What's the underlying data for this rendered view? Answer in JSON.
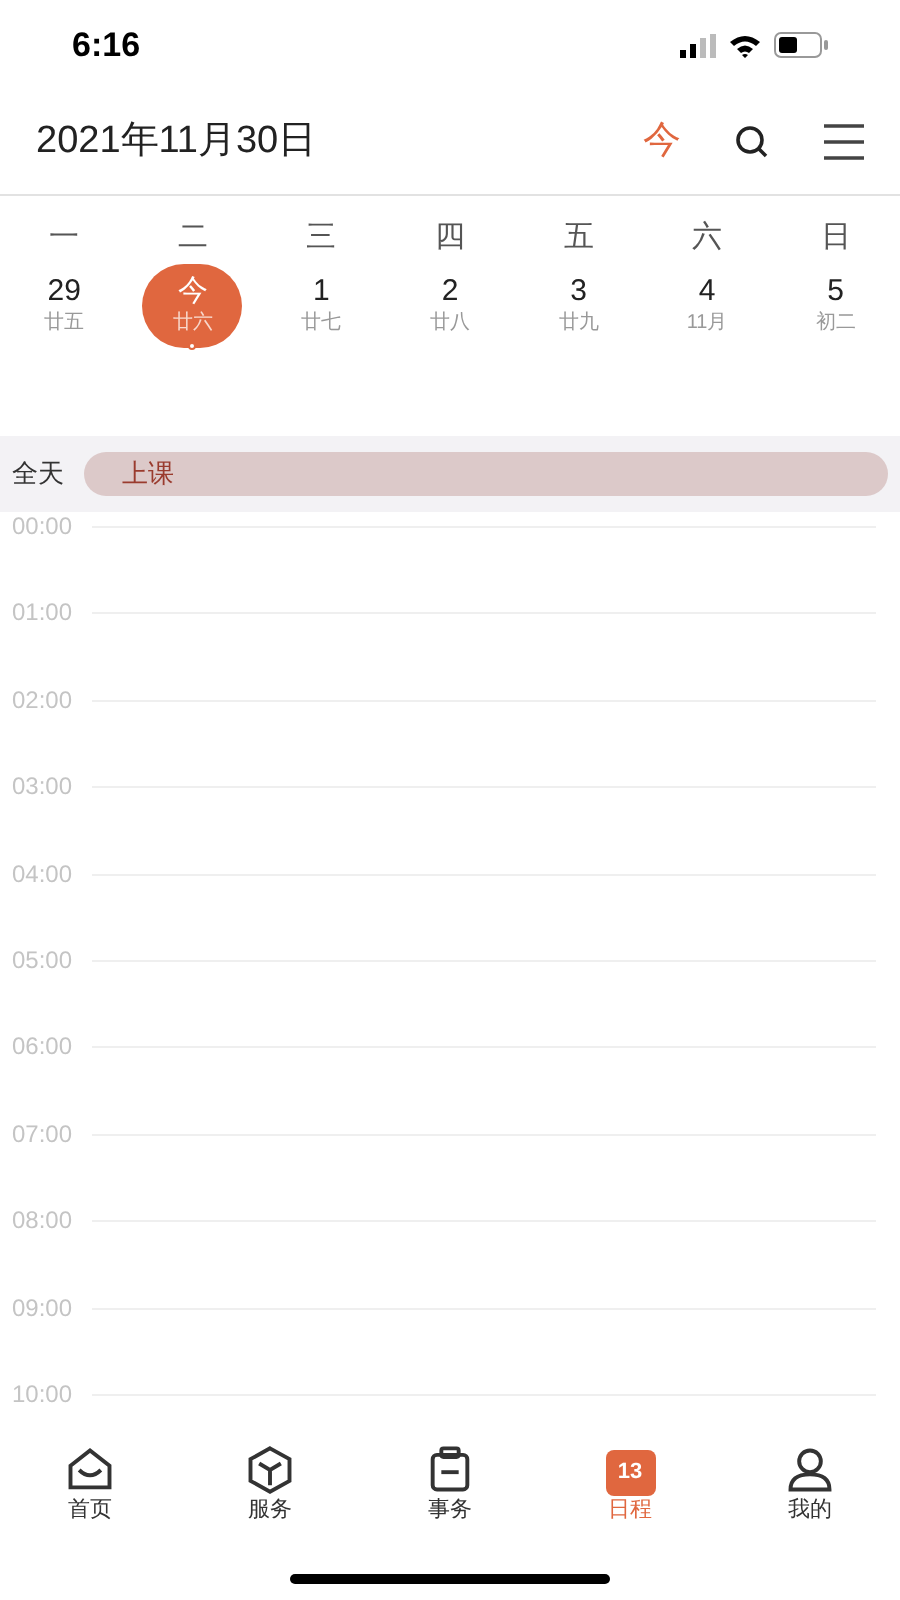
{
  "status_bar": {
    "time": "6:16"
  },
  "header": {
    "title": "2021年11月30日",
    "today_button": "今"
  },
  "weekdays": [
    "一",
    "二",
    "三",
    "四",
    "五",
    "六",
    "日"
  ],
  "days": [
    {
      "day": "29",
      "lunar": "廿五",
      "selected": false
    },
    {
      "day": "今",
      "lunar": "廿六",
      "selected": true
    },
    {
      "day": "1",
      "lunar": "廿七",
      "selected": false
    },
    {
      "day": "2",
      "lunar": "廿八",
      "selected": false
    },
    {
      "day": "3",
      "lunar": "廿九",
      "selected": false
    },
    {
      "day": "4",
      "lunar": "11月",
      "selected": false
    },
    {
      "day": "5",
      "lunar": "初二",
      "selected": false
    }
  ],
  "all_day": {
    "label": "全天",
    "events": [
      {
        "title": "上课",
        "color": "#dcc9c9"
      }
    ]
  },
  "hours": [
    "00:00",
    "01:00",
    "02:00",
    "03:00",
    "04:00",
    "05:00",
    "06:00",
    "07:00",
    "08:00",
    "09:00",
    "10:00"
  ],
  "tab_bar": [
    {
      "kind": "home",
      "label": "首页",
      "selected": false
    },
    {
      "kind": "service",
      "label": "服务",
      "selected": false
    },
    {
      "kind": "task",
      "label": "事务",
      "selected": false
    },
    {
      "kind": "calendar",
      "label": "日程",
      "selected": true,
      "icon_text": "13"
    },
    {
      "kind": "me",
      "label": "我的",
      "selected": false
    }
  ]
}
